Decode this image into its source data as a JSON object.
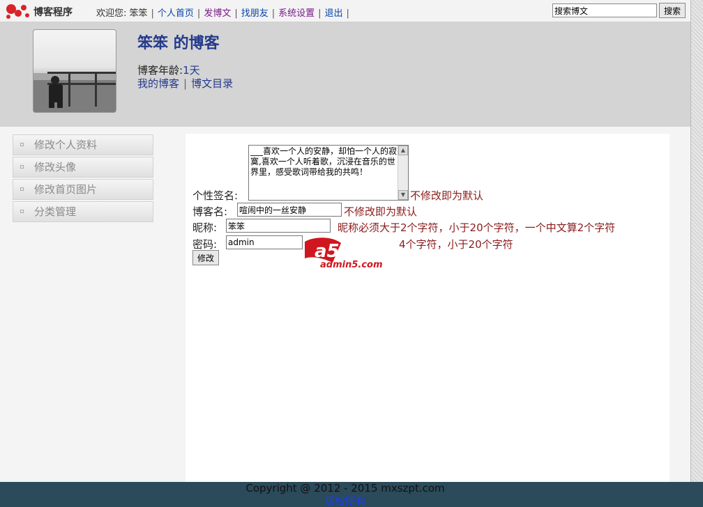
{
  "topbar": {
    "brand": "博客程序",
    "welcome": "欢迎您: 笨笨",
    "links": [
      "个人首页",
      "发博文",
      "找朋友",
      "系统设置",
      "退出"
    ],
    "search_value": "搜索博文",
    "search_button": "搜索"
  },
  "header": {
    "title": "笨笨 的博客",
    "age_label": "博客年龄:",
    "age_value": "1天",
    "links": [
      "我的博客",
      "博文目录"
    ]
  },
  "sidebar": {
    "items": [
      "修改个人资料",
      "修改头像",
      "修改首页图片",
      "分类管理"
    ]
  },
  "form": {
    "signature_label": "个性签名:",
    "signature_value": "___喜欢一个人的安静，却怕一个人的寂寞,喜欢一个人听着歌，沉浸在音乐的世界里，感受歌词带给我的共鸣！",
    "signature_hint": "不修改即为默认",
    "blogname_label": "博客名:",
    "blogname_value": "喧闹中的一丝安静",
    "blogname_hint": "不修改即为默认",
    "nickname_label": "昵称:",
    "nickname_value": "笨笨",
    "nickname_hint": "昵称必须大于2个字符，小于20个字符，一个中文算2个字符",
    "password_label": "密码:",
    "password_value": "admin",
    "password_hint": "4个字符，小于20个字符",
    "submit": "修改"
  },
  "watermark": {
    "brand": "a5下载",
    "site": "admin5.com"
  },
  "footer": {
    "copyright": "Copyright @ 2012 - 2015 mxszpt.com",
    "rights": "版权所有"
  }
}
